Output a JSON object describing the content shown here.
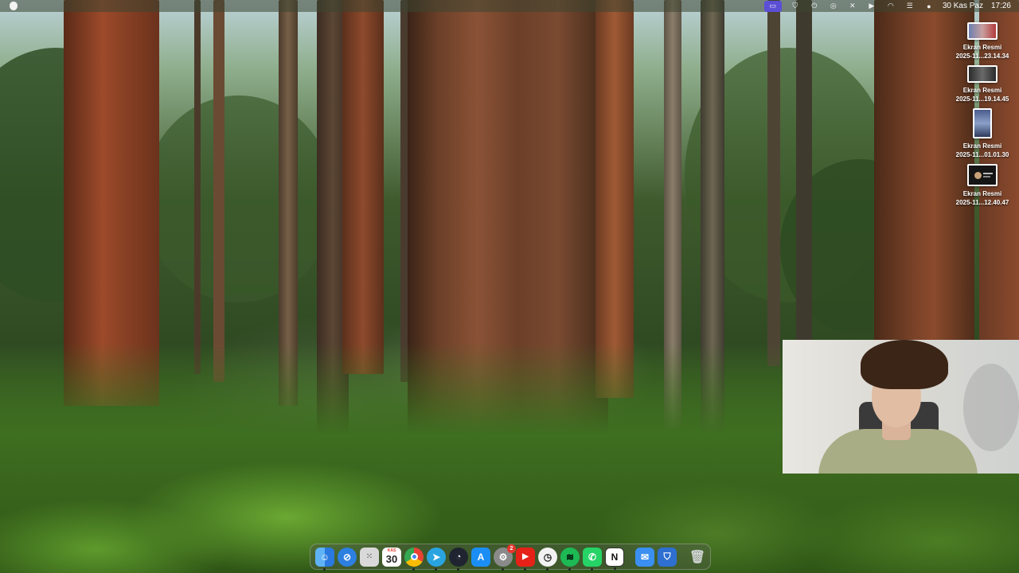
{
  "menubar": {
    "date": "30 Kas Paz",
    "time": "17:26",
    "status_icons": [
      "screen-mirroring-icon",
      "shield-icon",
      "power-icon",
      "airdrop-icon",
      "mute-icon",
      "play-icon",
      "wifi-icon",
      "control-center-icon",
      "siri-icon"
    ]
  },
  "desktop": {
    "files": [
      {
        "name_line1": "Ekran Resmi",
        "name_line2": "2025-11...23.14.34"
      },
      {
        "name_line1": "Ekran Resmi",
        "name_line2": "2025-11...19.14.45"
      },
      {
        "name_line1": "Ekran Resmi",
        "name_line2": "2025-11...01.01.30"
      },
      {
        "name_line1": "Ekran Resmi",
        "name_line2": "2025-11...12.40.47"
      }
    ]
  },
  "dock": {
    "apps": [
      {
        "icon": "finder-icon",
        "color": "#3d8ee8"
      },
      {
        "icon": "safari-icon",
        "color": "#2d7fe0"
      },
      {
        "icon": "launchpad-icon",
        "color": "#d9d9d9"
      },
      {
        "icon": "calendar-icon",
        "label": "30",
        "month": "KAS"
      },
      {
        "icon": "chrome-icon",
        "color": "#e9e9e9"
      },
      {
        "icon": "telegram-icon",
        "color": "#2aa4e0"
      },
      {
        "icon": "activity-monitor-icon",
        "color": "#1f2430"
      },
      {
        "icon": "app-store-icon",
        "color": "#1b8ef5"
      },
      {
        "icon": "system-settings-icon",
        "color": "#8a8a8a",
        "badge": "2"
      },
      {
        "icon": "youtube-icon",
        "color": "#e62117"
      },
      {
        "icon": "clock-icon",
        "color": "#f2f2f2"
      },
      {
        "icon": "spotify-icon",
        "color": "#1db954"
      },
      {
        "icon": "whatsapp-icon",
        "color": "#25d366"
      },
      {
        "icon": "notion-icon",
        "color": "#ffffff"
      },
      {
        "icon": "mail-icon",
        "color": "#3a8ff0"
      },
      {
        "icon": "bitwarden-icon",
        "color": "#2e6fd0"
      },
      {
        "icon": "trash-icon",
        "color": "#9aa0a0"
      }
    ]
  }
}
